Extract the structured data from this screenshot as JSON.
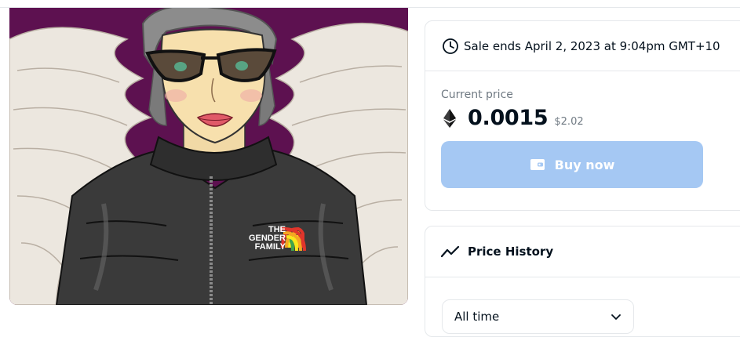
{
  "artwork": {
    "badge_line1": "THE",
    "badge_line2": "GENDER",
    "badge_line3": "FAMILY"
  },
  "sale": {
    "ends_text": "Sale ends April 2, 2023 at 9:04pm GMT+10",
    "current_price_label": "Current price",
    "price_eth": "0.0015",
    "price_usd": "$2.02",
    "buy_label": "Buy now",
    "buy_button_color": "#a5c8f3"
  },
  "price_history": {
    "title": "Price History",
    "range_selected": "All time"
  },
  "icons": {
    "clock": "clock-icon",
    "eth": "ethereum-icon",
    "wallet": "wallet-icon",
    "trend": "trend-line-icon",
    "chevron": "chevron-down-icon"
  },
  "colors": {
    "art_background": "#5d1150",
    "text_primary": "#04111d",
    "text_secondary": "#707a83",
    "border": "#e5e8eb"
  }
}
